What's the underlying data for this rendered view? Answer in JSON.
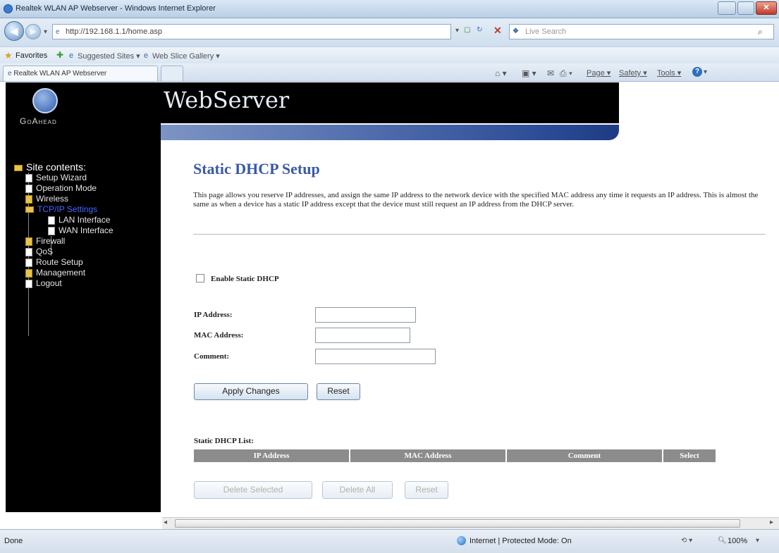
{
  "browser": {
    "window_title": "Realtek WLAN AP Webserver - Windows Internet Explorer",
    "url": "http://192.168.1.1/home.asp",
    "search_placeholder": "Live Search",
    "favorites_label": "Favorites",
    "suggested_sites": "Suggested Sites ▾",
    "web_slice": "Web Slice Gallery ▾",
    "tab_title": "Realtek WLAN AP Webserver",
    "cmd_page": "Page ▾",
    "cmd_safety": "Safety ▾",
    "cmd_tools": "Tools ▾",
    "status_left": "Done",
    "status_zone": "Internet | Protected Mode: On",
    "zoom": "100%"
  },
  "app": {
    "banner_title": "WebServer",
    "logo_text": "GoAhead"
  },
  "sidebar": {
    "header": "Site contents:",
    "items": [
      {
        "label": "Setup Wizard",
        "type": "doc",
        "level": 1
      },
      {
        "label": "Operation Mode",
        "type": "doc",
        "level": 1
      },
      {
        "label": "Wireless",
        "type": "folder",
        "level": 1
      },
      {
        "label": "TCP/IP Settings",
        "type": "folder-open",
        "level": 1,
        "active": true
      },
      {
        "label": "LAN Interface",
        "type": "doc",
        "level": 2
      },
      {
        "label": "WAN Interface",
        "type": "doc",
        "level": 2
      },
      {
        "label": "Firewall",
        "type": "folder",
        "level": 1
      },
      {
        "label": "QoS",
        "type": "doc",
        "level": 1
      },
      {
        "label": "Route Setup",
        "type": "doc",
        "level": 1
      },
      {
        "label": "Management",
        "type": "folder",
        "level": 1
      },
      {
        "label": "Logout",
        "type": "doc",
        "level": 1
      }
    ]
  },
  "main": {
    "title": "Static DHCP Setup",
    "description": "This page allows you reserve IP addresses, and assign the same IP address to the network device with the specified MAC address any time it requests an IP address. This is almost the same as when a device has a static IP address except that the device must still request an IP address from the DHCP server.",
    "enable_label": "Enable Static DHCP",
    "enable_checked": false,
    "ip_label": "IP Address:",
    "ip_value": "",
    "mac_label": "MAC Address:",
    "mac_value": "",
    "comment_label": "Comment:",
    "comment_value": "",
    "apply_button": "Apply Changes",
    "reset_button": "Reset",
    "list_title": "Static DHCP List:",
    "columns": [
      "IP Address",
      "MAC Address",
      "Comment",
      "Select"
    ],
    "rows": [],
    "delete_selected": "Delete Selected",
    "delete_all": "Delete All",
    "list_reset": "Reset"
  }
}
